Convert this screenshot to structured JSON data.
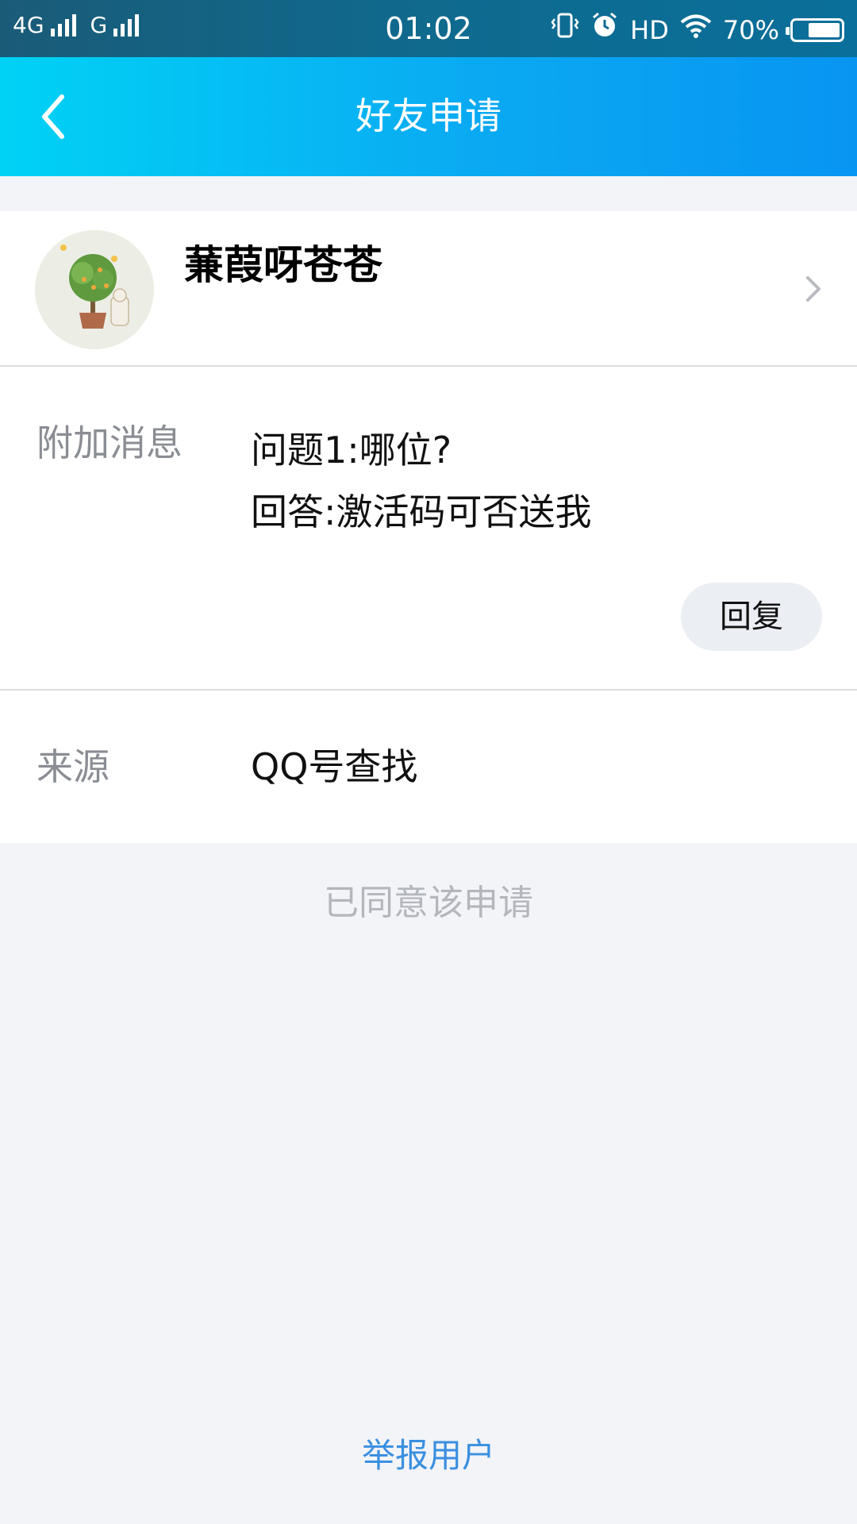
{
  "status_bar": {
    "network1": "4G",
    "network2": "G",
    "time": "01:02",
    "hd": "HD",
    "battery_percent": "70%",
    "battery_level": 0.7,
    "icons": [
      "vibrate-icon",
      "alarm-icon",
      "wifi-icon",
      "battery-icon"
    ]
  },
  "header": {
    "title": "好友申请",
    "back_icon": "chevron-left-icon"
  },
  "profile": {
    "nickname": "蒹葭呀苍苍",
    "avatar_icon": "avatar",
    "chevron_icon": "chevron-right-icon"
  },
  "message": {
    "label": "附加消息",
    "line1": "问题1:哪位?",
    "line2": "回答:激活码可否送我",
    "reply_label": "回复"
  },
  "source": {
    "label": "来源",
    "value": "QQ号查找"
  },
  "status_text": "已同意该申请",
  "report_label": "举报用户",
  "colors": {
    "header_start": "#00d2f5",
    "header_end": "#0895f2",
    "link": "#3a8fe0",
    "background": "#f2f4f8"
  }
}
